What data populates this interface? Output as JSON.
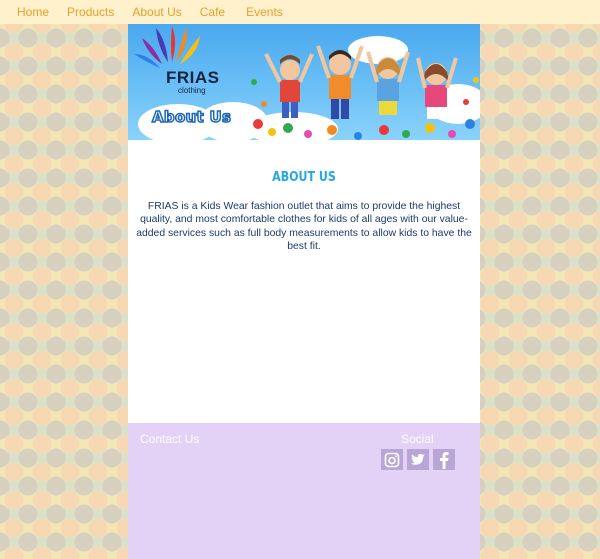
{
  "nav": {
    "items": [
      {
        "label": "Home"
      },
      {
        "label": "Products"
      },
      {
        "label": "About Us"
      },
      {
        "label": "Cafe"
      },
      {
        "label": "Events"
      }
    ]
  },
  "banner": {
    "logo_name": "FRIAS",
    "logo_sub": "clothing",
    "title": "About Us"
  },
  "content": {
    "heading": "ABOUT US",
    "description": "FRIAS is a Kids Wear fashion outlet that aims to provide the highest quality, and most comfortable clothes for kids of all ages with our value-added services such as full body measurements to allow kids to have the best fit."
  },
  "footer": {
    "contact_label": "Contact Us",
    "social_label": "Social",
    "social_icons": [
      "instagram-icon",
      "twitter-icon",
      "facebook-icon"
    ]
  },
  "colors": {
    "nav_bg": "#fff1cc",
    "nav_link": "#e7a02a",
    "heading": "#26a7e6",
    "text": "#1c3b6b",
    "footer_bg": "#e3d2f5",
    "icon_bg": "#b8a6d6"
  }
}
